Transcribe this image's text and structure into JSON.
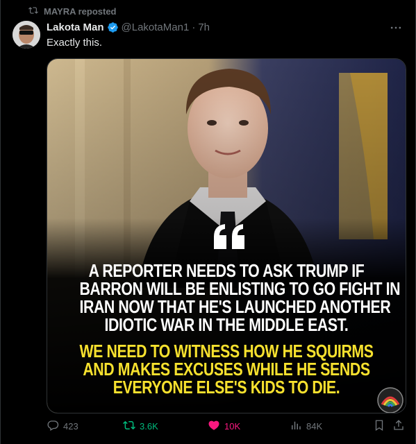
{
  "repost": {
    "text": "MAYRA reposted"
  },
  "author": {
    "name": "Lakota Man",
    "handle": "@LakotaMan1",
    "separator": "·",
    "time": "7h",
    "verified": true
  },
  "tweet": {
    "text": "Exactly this."
  },
  "image": {
    "quote_mark": "“",
    "white_lines": [
      "A REPORTER NEEDS TO ASK TRUMP IF",
      "BARRON WILL BE ENLISTING TO GO FIGHT IN",
      "IRAN NOW THAT HE'S LAUNCHED ANOTHER",
      "IDIOTIC WAR IN THE MIDDLE EAST."
    ],
    "yellow_lines": [
      "WE NEED TO WITNESS HOW HE SQUIRMS",
      "AND MAKES EXCUSES WHILE HE SENDS",
      "EVERYONE ELSE'S KIDS TO DIE."
    ],
    "highlight_color": "#f7e12e"
  },
  "actions": {
    "replies": "423",
    "reposts": "3.6K",
    "likes": "10K",
    "views": "84K"
  },
  "colors": {
    "background": "#000000",
    "muted": "#71767b",
    "text": "#e7e9ea",
    "repost_active": "#00ba7c",
    "like_active": "#f91880",
    "verified_blue": "#1d9bf0"
  },
  "icons": [
    "repost-icon",
    "verified-badge-icon",
    "more-icon",
    "reply-icon",
    "repost-icon",
    "heart-icon",
    "views-icon",
    "bookmark-icon",
    "share-icon"
  ]
}
